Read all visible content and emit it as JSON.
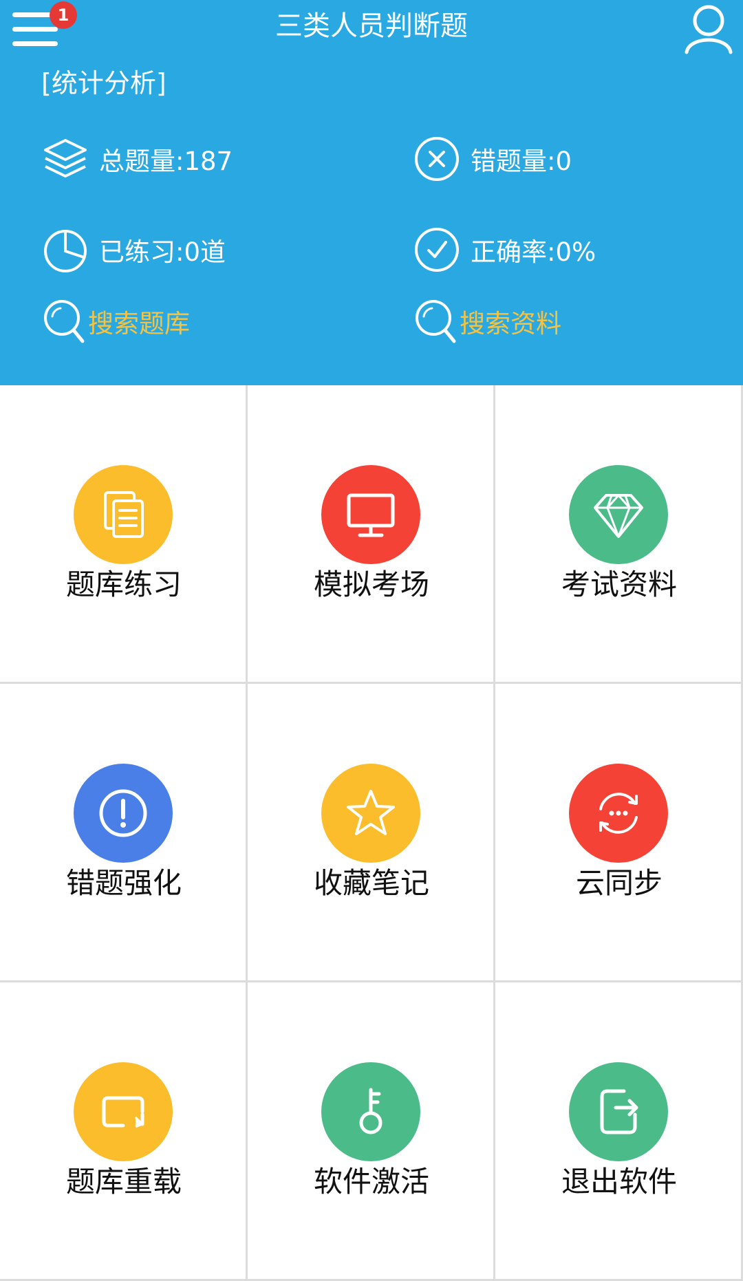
{
  "header": {
    "title": "三类人员判断题",
    "badge_count": "1",
    "section_label": "[统计分析]",
    "stats": {
      "total": "总题量:187",
      "wrong": "错题量:0",
      "practiced": "已练习:0道",
      "accuracy": "正确率:0%"
    },
    "search": {
      "question_bank": "搜索题库",
      "materials": "搜索资料"
    },
    "colors": {
      "background": "#2aa8e2",
      "search_text": "#f5c342"
    }
  },
  "grid": {
    "items": [
      {
        "label": "题库练习",
        "icon": "documents-icon",
        "color": "#fbbd2c"
      },
      {
        "label": "模拟考场",
        "icon": "monitor-icon",
        "color": "#f44336"
      },
      {
        "label": "考试资料",
        "icon": "diamond-icon",
        "color": "#4cbb8a"
      },
      {
        "label": "错题强化",
        "icon": "exclamation-icon",
        "color": "#4a7fe8"
      },
      {
        "label": "收藏笔记",
        "icon": "star-icon",
        "color": "#fbbd2c"
      },
      {
        "label": "云同步",
        "icon": "sync-icon",
        "color": "#f44336"
      },
      {
        "label": "题库重载",
        "icon": "reload-icon",
        "color": "#fbbd2c"
      },
      {
        "label": "软件激活",
        "icon": "key-icon",
        "color": "#4cbb8a"
      },
      {
        "label": "退出软件",
        "icon": "exit-icon",
        "color": "#4cbb8a"
      }
    ]
  }
}
